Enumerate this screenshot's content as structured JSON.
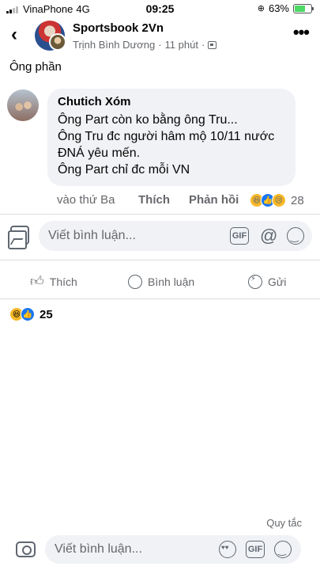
{
  "status_bar": {
    "carrier": "VinaPhone",
    "network": "4G",
    "time": "09:25",
    "battery": "63%",
    "battery_level": 0.63
  },
  "header": {
    "back_icon": "chevron-left-icon",
    "title": "Sportsbook 2Vn",
    "author": "Trịnh Bình Dương",
    "separator": "·",
    "time_ago": "11 phút",
    "group_icon": "group-icon",
    "more_icon": "more-horizontal-icon"
  },
  "post": {
    "snippet": "Ông phần"
  },
  "comment": {
    "author": "Chutich Xóm",
    "lines": [
      "Ông Part còn ko bằng ông Tru...",
      "Ông Tru đc người hâm mộ 10/11 nước",
      "ĐNÁ yêu mến.",
      "Ông Part chỉ đc mỗi VN"
    ],
    "time": "vào thứ Ba",
    "like_label": "Thích",
    "reply_label": "Phản hồi",
    "reactions": [
      "haha",
      "like",
      "sad"
    ],
    "reaction_count": "28"
  },
  "composer": {
    "placeholder": "Viết bình luận...",
    "gif_label": "GIF",
    "at_label": "@"
  },
  "post_actions": {
    "like_label": "Thích",
    "comment_label": "Bình luận",
    "share_label": "Gửi"
  },
  "post_reactions": {
    "types": [
      "haha",
      "like"
    ],
    "count": "25"
  },
  "footer": {
    "rules_label": "Quy tắc",
    "placeholder": "Viết bình luận...",
    "gif_label": "GIF"
  },
  "colors": {
    "accent": "#1877f2",
    "bubble_bg": "#f0f2f5",
    "muted_text": "#65676b"
  }
}
